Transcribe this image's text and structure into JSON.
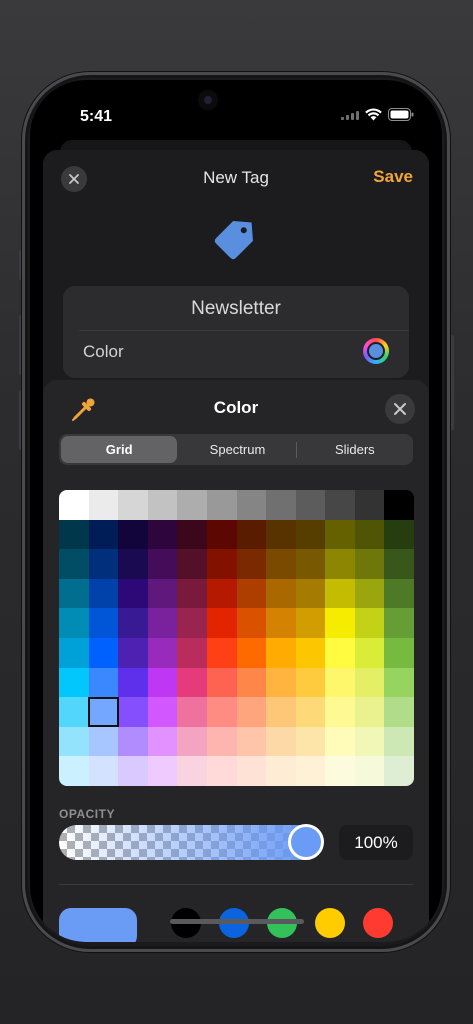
{
  "status": {
    "time": "5:41"
  },
  "nav": {
    "title": "New Tag",
    "save_label": "Save"
  },
  "tag": {
    "name": "Newsletter",
    "color_label": "Color"
  },
  "picker": {
    "title": "Color",
    "segments": [
      "Grid",
      "Spectrum",
      "Sliders"
    ],
    "selected_segment": "Grid",
    "opacity_label": "OPACITY",
    "opacity_value": "100%",
    "selected_color": "#6a9cf5",
    "swatches": [
      "#000000",
      "#0a64e0",
      "#33c25a",
      "#ffcc00",
      "#ff3b30"
    ]
  },
  "grid_colors": [
    [
      "#ffffff",
      "#ebebeb",
      "#d6d6d6",
      "#c2c2c2",
      "#adadad",
      "#999999",
      "#858585",
      "#707070",
      "#5c5c5c",
      "#474747",
      "#333333",
      "#000000"
    ],
    [
      "#00374a",
      "#011d57",
      "#11053b",
      "#2e063d",
      "#3c071b",
      "#5c0701",
      "#5a1c00",
      "#583300",
      "#563d00",
      "#666100",
      "#4f5504",
      "#263e0f"
    ],
    [
      "#004d65",
      "#012f7b",
      "#1a0a52",
      "#450d59",
      "#551029",
      "#831100",
      "#7b2900",
      "#7a4a00",
      "#785800",
      "#8c8602",
      "#6f760a",
      "#38571a"
    ],
    [
      "#016e8f",
      "#0042a9",
      "#2c0977",
      "#61187c",
      "#791a3d",
      "#b51a00",
      "#ad3e00",
      "#a96800",
      "#a67b01",
      "#c4bc00",
      "#9ba50e",
      "#4e7a27"
    ],
    [
      "#008cb4",
      "#0056d6",
      "#371a94",
      "#7a219e",
      "#99244f",
      "#e22400",
      "#da5100",
      "#d38301",
      "#d19d01",
      "#f5ec00",
      "#c3d117",
      "#669d34"
    ],
    [
      "#00a1d8",
      "#0061fe",
      "#4d22b2",
      "#982abc",
      "#b92d5d",
      "#ff4015",
      "#ff6a00",
      "#ffab01",
      "#fcc700",
      "#fefb41",
      "#d9ec37",
      "#76bb40"
    ],
    [
      "#01c7fc",
      "#3a87fe",
      "#5e30eb",
      "#be38f3",
      "#e63b7a",
      "#fe6250",
      "#fe8648",
      "#feb43f",
      "#fecb3e",
      "#fff76b",
      "#e4ef65",
      "#96d35f"
    ],
    [
      "#52d6fc",
      "#74a7ff",
      "#864ffe",
      "#d357fe",
      "#ee719e",
      "#ff8c82",
      "#fea57d",
      "#fec777",
      "#fed977",
      "#fff994",
      "#eaf28f",
      "#b1dd8b"
    ],
    [
      "#93e3fc",
      "#a7c6ff",
      "#b18cfe",
      "#e292fe",
      "#f4a4c0",
      "#ffb5af",
      "#ffc5ab",
      "#fed9a8",
      "#fde4a8",
      "#fffbb9",
      "#f1f7b7",
      "#cde8b5"
    ],
    [
      "#cbf0ff",
      "#d3e2ff",
      "#d9c9fe",
      "#efcaff",
      "#f9d3e0",
      "#ffdad8",
      "#ffe2d6",
      "#feecd4",
      "#fef1d5",
      "#fdfbdd",
      "#f6fadb",
      "#deeed4"
    ]
  ]
}
